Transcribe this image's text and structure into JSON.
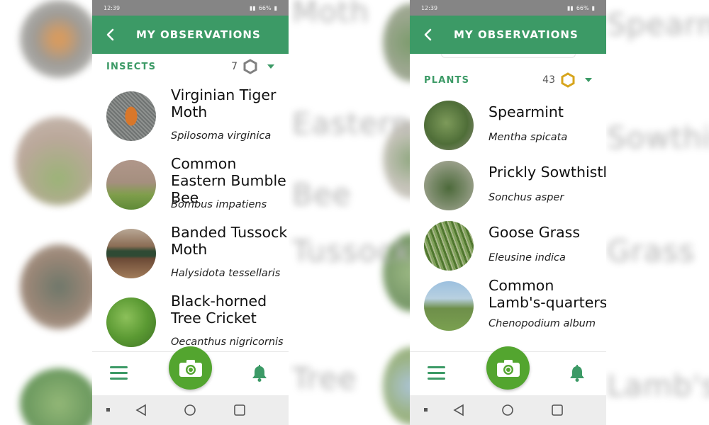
{
  "colors": {
    "brand_green": "#3c9a66",
    "camera_green": "#53a52f",
    "status_gray": "#858585"
  },
  "background_words": [
    "Moth",
    "Eastern",
    "Bee",
    "Tussock",
    "Tree",
    "Spearmint",
    "Sowthistle",
    "Grass",
    "Lamb's-quarters"
  ],
  "screens": [
    {
      "status": {
        "time": "12:39",
        "battery": "66%"
      },
      "header": {
        "title": "MY OBSERVATIONS",
        "back_icon": "chevron-left-icon"
      },
      "section": {
        "category": "INSECTS",
        "count": "7",
        "badge_icon": "hexagon-icon",
        "badge_color": "#808080"
      },
      "items": [
        {
          "common": "Virginian Tiger Moth",
          "scientific": "Spilosoma virginica"
        },
        {
          "common": "Common Eastern Bumble Bee",
          "scientific": "Bombus impatiens"
        },
        {
          "common": "Banded Tussock Moth",
          "scientific": "Halysidota tessellaris"
        },
        {
          "common": "Black-horned Tree Cricket",
          "scientific": "Oecanthus nigricornis"
        }
      ],
      "nav": {
        "menu_icon": "menu-icon",
        "camera_icon": "camera-icon",
        "bell_icon": "bell-icon"
      }
    },
    {
      "status": {
        "time": "12:39",
        "battery": "66%"
      },
      "header": {
        "title": "MY OBSERVATIONS",
        "back_icon": "chevron-left-icon"
      },
      "section": {
        "category": "PLANTS",
        "count": "43",
        "badge_icon": "hexagon-icon",
        "badge_color": "#d7a51d"
      },
      "items": [
        {
          "common": "Spearmint",
          "scientific": "Mentha spicata"
        },
        {
          "common": "Prickly Sowthistle",
          "scientific": "Sonchus asper"
        },
        {
          "common": "Goose Grass",
          "scientific": "Eleusine indica"
        },
        {
          "common": "Common Lamb's-quarters",
          "scientific": "Chenopodium album"
        }
      ],
      "nav": {
        "menu_icon": "menu-icon",
        "camera_icon": "camera-icon",
        "bell_icon": "bell-icon"
      }
    }
  ]
}
